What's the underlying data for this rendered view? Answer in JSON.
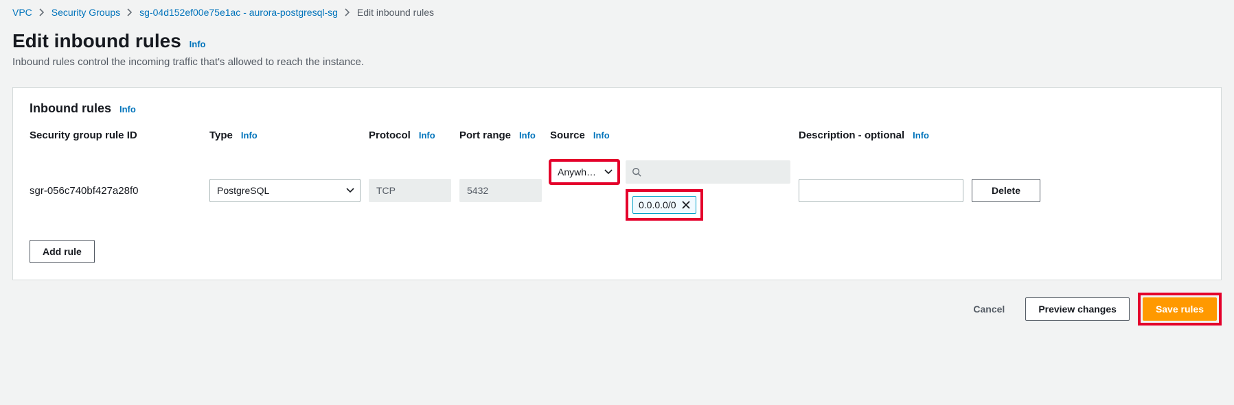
{
  "breadcrumb": {
    "items": [
      {
        "label": "VPC",
        "link": true
      },
      {
        "label": "Security Groups",
        "link": true
      },
      {
        "label": "sg-04d152ef00e75e1ac - aurora-postgresql-sg",
        "link": true
      },
      {
        "label": "Edit inbound rules",
        "link": false
      }
    ]
  },
  "page": {
    "title": "Edit inbound rules",
    "info": "Info",
    "description": "Inbound rules control the incoming traffic that's allowed to reach the instance."
  },
  "panel": {
    "title": "Inbound rules",
    "info": "Info"
  },
  "columns": {
    "rule_id": "Security group rule ID",
    "type": "Type",
    "protocol": "Protocol",
    "port_range": "Port range",
    "source": "Source",
    "description": "Description - optional",
    "info": "Info"
  },
  "rule": {
    "id": "sgr-056c740bf427a28f0",
    "type": "PostgreSQL",
    "protocol": "TCP",
    "port_range": "5432",
    "source_select": "Anywh…",
    "source_chip": "0.0.0.0/0",
    "description": "",
    "delete": "Delete"
  },
  "actions": {
    "add_rule": "Add rule",
    "cancel": "Cancel",
    "preview": "Preview changes",
    "save": "Save rules"
  }
}
